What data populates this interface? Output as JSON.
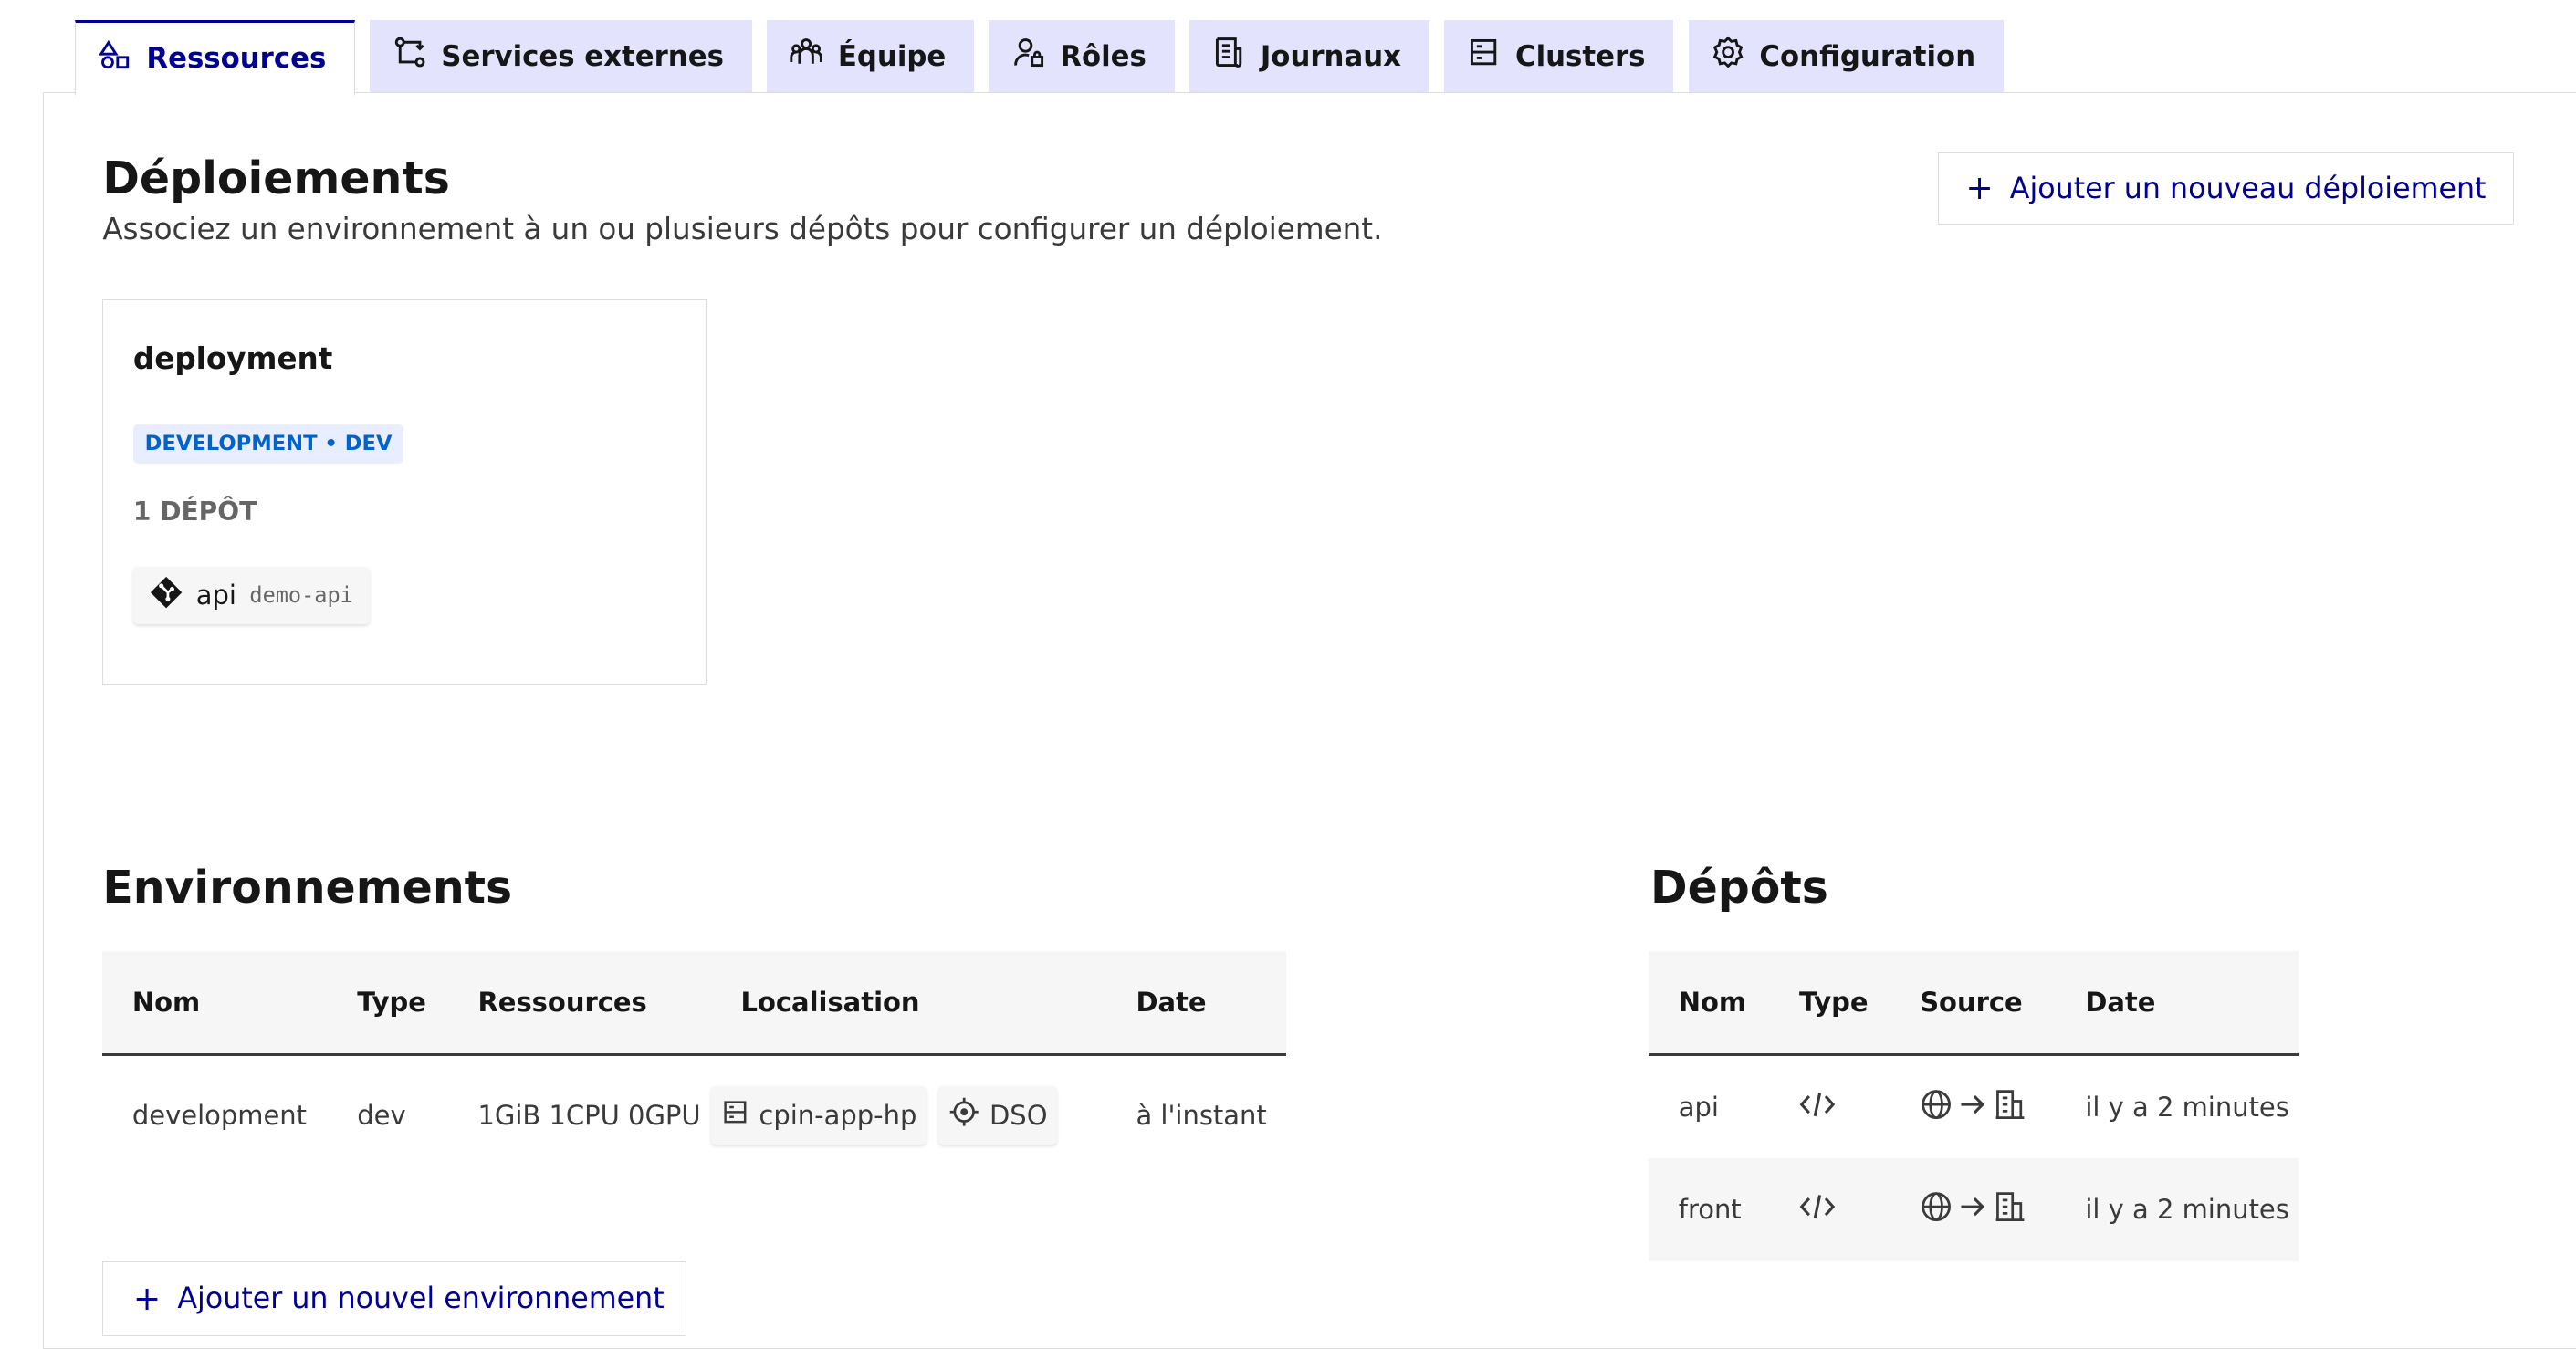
{
  "tabs": [
    {
      "label": "Ressources",
      "icon": "shapes-icon"
    },
    {
      "label": "Services externes",
      "icon": "services-icon"
    },
    {
      "label": "Équipe",
      "icon": "team-icon"
    },
    {
      "label": "Rôles",
      "icon": "user-lock-icon"
    },
    {
      "label": "Journaux",
      "icon": "newspaper-icon"
    },
    {
      "label": "Clusters",
      "icon": "server-icon"
    },
    {
      "label": "Configuration",
      "icon": "gear-icon"
    }
  ],
  "deployments": {
    "title": "Déploiements",
    "description": "Associez un environnement à un ou plusieurs dépôts pour configurer un déploiement.",
    "add_label": "Ajouter un nouveau déploiement",
    "card": {
      "name": "deployment",
      "badge": "DEVELOPMENT • DEV",
      "repo_count": "1 DÉPÔT",
      "repo_name": "api",
      "repo_slug": "demo-api"
    }
  },
  "environments": {
    "title": "Environnements",
    "columns": [
      "Nom",
      "Type",
      "Ressources",
      "Localisation",
      "Date"
    ],
    "rows": [
      {
        "name": "development",
        "type": "dev",
        "resources": "1GiB 1CPU 0GPU",
        "cluster": "cpin-app-hp",
        "zone": "DSO",
        "date": "à l'instant"
      }
    ],
    "add_label": "Ajouter un nouvel environnement"
  },
  "repositories": {
    "title": "Dépôts",
    "columns": [
      "Nom",
      "Type",
      "Source",
      "Date"
    ],
    "rows": [
      {
        "name": "api",
        "date": "il y a 2 minutes"
      },
      {
        "name": "front",
        "date": "il y a 2 minutes"
      }
    ]
  },
  "colors": {
    "primary": "#000091",
    "tab_bg": "#e3e3fd",
    "badge_bg": "#e8edff",
    "badge_text": "#0063cb"
  }
}
